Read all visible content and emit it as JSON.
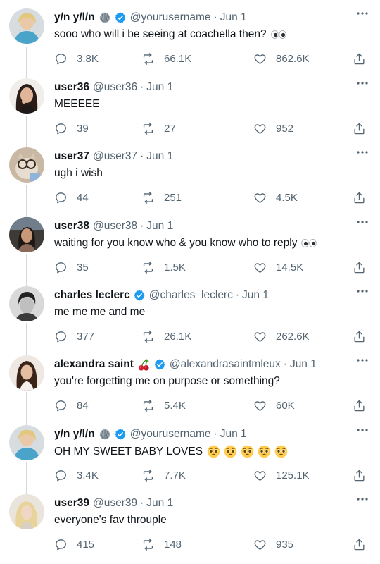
{
  "tweets": [
    {
      "name": "y/n y/l/n",
      "handle": "@yourusername",
      "date": "Jun 1",
      "text": "sooo who will i be seeing at coachella then?",
      "replies": "3.8K",
      "retweets": "66.1K",
      "likes": "862.6K",
      "name_emoji": "shell-icon",
      "verified": true,
      "text_emoji": "eyes"
    },
    {
      "name": "user36",
      "handle": "@user36",
      "date": "Jun 1",
      "text": "MEEEEE",
      "replies": "39",
      "retweets": "27",
      "likes": "952"
    },
    {
      "name": "user37",
      "handle": "@user37",
      "date": "Jun 1",
      "text": "ugh i wish",
      "replies": "44",
      "retweets": "251",
      "likes": "4.5K"
    },
    {
      "name": "user38",
      "handle": "@user38",
      "date": "Jun 1",
      "text": "waiting for you know who & you know who to reply",
      "replies": "35",
      "retweets": "1.5K",
      "likes": "14.5K",
      "text_emoji": "eyes"
    },
    {
      "name": "charles leclerc",
      "handle": "@charles_leclerc",
      "date": "Jun 1",
      "text": "me me me and me",
      "replies": "377",
      "retweets": "26.1K",
      "likes": "262.6K",
      "verified": true
    },
    {
      "name": "alexandra saint",
      "handle": "@alexandrasaintmleux",
      "date": "Jun 1",
      "text": "you're forgetting me on purpose or something?",
      "replies": "84",
      "retweets": "5.4K",
      "likes": "60K",
      "name_emoji": "cherries-icon",
      "verified": true
    },
    {
      "name": "y/n y/l/n",
      "handle": "@yourusername",
      "date": "Jun 1",
      "text": "OH MY SWEET BABY LOVES",
      "replies": "3.4K",
      "retweets": "7.7K",
      "likes": "125.1K",
      "name_emoji": "shell-icon",
      "verified": true,
      "text_emoji": "pleading-face x5"
    },
    {
      "name": "user39",
      "handle": "@user39",
      "date": "Jun 1",
      "text": "everyone's fav throuple",
      "replies": "415",
      "retweets": "148",
      "likes": "935"
    }
  ],
  "colors": {
    "verified": "#1d9bf0",
    "secondary_text": "#536471",
    "thread_line": "#cfd9de"
  }
}
